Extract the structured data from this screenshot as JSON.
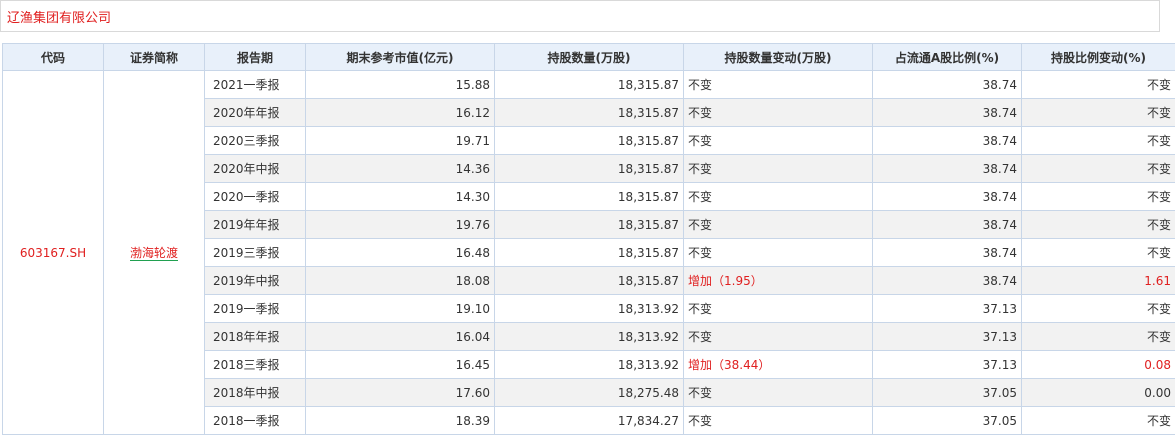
{
  "company": "辽渔集团有限公司",
  "headers": [
    "代码",
    "证券简称",
    "报告期",
    "期末参考市值(亿元)",
    "持股数量(万股)",
    "持股数量变动(万股)",
    "占流通A股比例(%)",
    "持股比例变动(%)"
  ],
  "code": "603167.SH",
  "stock_name": "渤海轮渡",
  "rows": [
    {
      "period": "2021一季报",
      "mv": "15.88",
      "shares": "18,315.87",
      "change": "不变",
      "ratio": "38.74",
      "ratio_change": "不变",
      "highlight": false
    },
    {
      "period": "2020年年报",
      "mv": "16.12",
      "shares": "18,315.87",
      "change": "不变",
      "ratio": "38.74",
      "ratio_change": "不变",
      "highlight": false
    },
    {
      "period": "2020三季报",
      "mv": "19.71",
      "shares": "18,315.87",
      "change": "不变",
      "ratio": "38.74",
      "ratio_change": "不变",
      "highlight": false
    },
    {
      "period": "2020年中报",
      "mv": "14.36",
      "shares": "18,315.87",
      "change": "不变",
      "ratio": "38.74",
      "ratio_change": "不变",
      "highlight": false
    },
    {
      "period": "2020一季报",
      "mv": "14.30",
      "shares": "18,315.87",
      "change": "不变",
      "ratio": "38.74",
      "ratio_change": "不变",
      "highlight": false
    },
    {
      "period": "2019年年报",
      "mv": "19.76",
      "shares": "18,315.87",
      "change": "不变",
      "ratio": "38.74",
      "ratio_change": "不变",
      "highlight": false
    },
    {
      "period": "2019三季报",
      "mv": "16.48",
      "shares": "18,315.87",
      "change": "不变",
      "ratio": "38.74",
      "ratio_change": "不变",
      "highlight": false
    },
    {
      "period": "2019年中报",
      "mv": "18.08",
      "shares": "18,315.87",
      "change": "增加（1.95）",
      "ratio": "38.74",
      "ratio_change": "1.61",
      "highlight": true
    },
    {
      "period": "2019一季报",
      "mv": "19.10",
      "shares": "18,313.92",
      "change": "不变",
      "ratio": "37.13",
      "ratio_change": "不变",
      "highlight": false
    },
    {
      "period": "2018年年报",
      "mv": "16.04",
      "shares": "18,313.92",
      "change": "不变",
      "ratio": "37.13",
      "ratio_change": "不变",
      "highlight": false
    },
    {
      "period": "2018三季报",
      "mv": "16.45",
      "shares": "18,313.92",
      "change": "增加（38.44）",
      "ratio": "37.13",
      "ratio_change": "0.08",
      "highlight": true
    },
    {
      "period": "2018年中报",
      "mv": "17.60",
      "shares": "18,275.48",
      "change": "不变",
      "ratio": "37.05",
      "ratio_change": "0.00",
      "highlight": false
    },
    {
      "period": "2018一季报",
      "mv": "18.39",
      "shares": "17,834.27",
      "change": "不变",
      "ratio": "37.05",
      "ratio_change": "不变",
      "highlight": false
    }
  ],
  "colors": {
    "accent_red": "#e02020",
    "header_bg": "#e8f0fa",
    "border": "#c8d6e8",
    "alt_row": "#f2f2f2"
  }
}
